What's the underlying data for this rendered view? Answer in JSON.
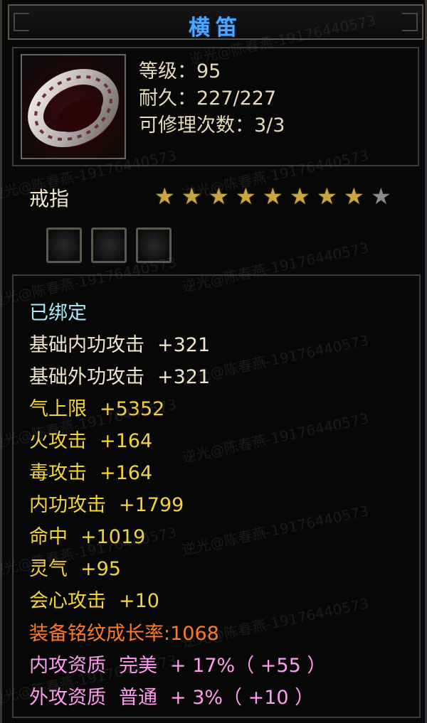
{
  "title": "横笛",
  "info": {
    "level": "等级：95",
    "durability": "耐久：227/227",
    "repair": "可修理次数：3/3"
  },
  "item_type": "戒指",
  "stars": {
    "filled": 8,
    "total": 9
  },
  "socket_count": 3,
  "bound_status": "已绑定",
  "stats": [
    {
      "label": "基础内功攻击",
      "value": "+321",
      "color": "white"
    },
    {
      "label": "基础外功攻击",
      "value": "+321",
      "color": "white"
    },
    {
      "label": "气上限",
      "value": "+5352",
      "color": "yellow"
    },
    {
      "label": "火攻击",
      "value": "+164",
      "color": "yellow"
    },
    {
      "label": "毒攻击",
      "value": "+164",
      "color": "yellow"
    },
    {
      "label": "内功攻击",
      "value": "+1799",
      "color": "yellow"
    },
    {
      "label": "命中",
      "value": "+1019",
      "color": "yellow"
    },
    {
      "label": "灵气",
      "value": "+95",
      "color": "yellow"
    },
    {
      "label": "会心攻击",
      "value": "+10",
      "color": "yellow"
    }
  ],
  "growth": "装备铭纹成长率:1068",
  "qualities": [
    {
      "label": "内攻资质",
      "grade": "完美",
      "value": "+ 17%（ +55 ）"
    },
    {
      "label": "外攻资质",
      "grade": "普通",
      "value": "+ 3%（ +10 ）"
    }
  ],
  "watermark": "逆光@陈春燕-19176440573",
  "colors": {
    "title": "#4aa6ff",
    "bound": "#a8ecff",
    "base_stat": "#f1e6cd",
    "stat": "#f4d335",
    "growth": "#ff7a22",
    "quality": "#ff9bf0",
    "star_on": "#c9a640",
    "star_off": "#8b8b8b"
  }
}
